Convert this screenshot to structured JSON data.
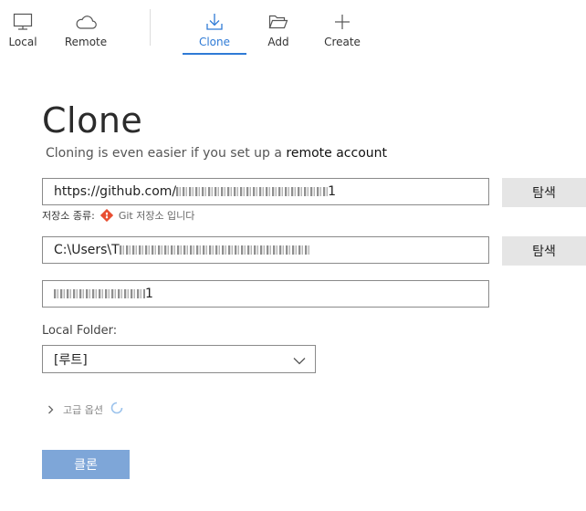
{
  "toolbar": {
    "items": [
      {
        "label": "Local",
        "icon": "monitor-icon",
        "active": false
      },
      {
        "label": "Remote",
        "icon": "cloud-icon",
        "active": false
      },
      {
        "label": "Clone",
        "icon": "download-icon",
        "active": true
      },
      {
        "label": "Add",
        "icon": "folder-open-icon",
        "active": false
      },
      {
        "label": "Create",
        "icon": "plus-icon",
        "active": false
      }
    ],
    "accent_color": "#2f7bd6"
  },
  "page": {
    "title": "Clone",
    "subtitle_text": "Cloning is even easier if you set up a ",
    "subtitle_link": "remote account"
  },
  "form": {
    "source_url_prefix": "https://github.com/",
    "source_url_suffix": "1",
    "browse_label_1": "탐색",
    "repo_type_label": "저장소 종류:",
    "repo_type_value": "Git 저장소 입니다",
    "dest_path_prefix": "C:\\Users\\T",
    "browse_label_2": "탐색",
    "name_suffix": "1",
    "local_folder_label": "Local Folder:",
    "local_folder_value": "[루트]",
    "advanced_label": "고급 옵션",
    "clone_button": "클론",
    "clone_button_color": "#7ea6d8",
    "git_icon_color": "#e84e31"
  }
}
